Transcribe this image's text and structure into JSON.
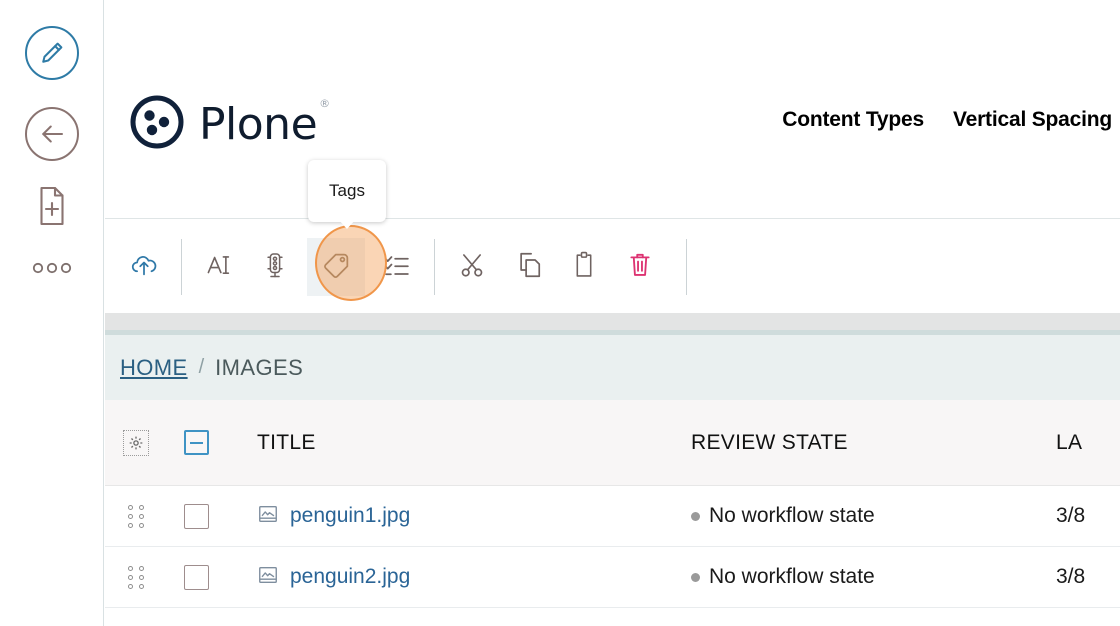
{
  "left_rail": {
    "items": [
      {
        "name": "edit",
        "icon": "pencil-circle-icon",
        "label": "Edit"
      },
      {
        "name": "back",
        "icon": "arrow-left-circle-icon",
        "label": "Back"
      },
      {
        "name": "add-content",
        "icon": "document-plus-icon",
        "label": "Add new content"
      },
      {
        "name": "more",
        "icon": "more-horizontal-icon",
        "label": "More"
      }
    ]
  },
  "header": {
    "logo_text": "Plone",
    "registered_mark": "®",
    "nav": [
      {
        "label": "Content Types"
      },
      {
        "label": "Vertical Spacing"
      }
    ]
  },
  "tooltip": {
    "label": "Tags",
    "for": "tags-button"
  },
  "toolbar": {
    "buttons": [
      {
        "name": "upload-button",
        "icon": "cloud-upload-icon",
        "label": "Upload",
        "color": "#3079a8",
        "active": false
      },
      {
        "name": "rename-button",
        "icon": "rename-ai-icon",
        "label": "Rename",
        "color": "#6f6361",
        "active": false
      },
      {
        "name": "workflow-state-button",
        "icon": "traffic-light-icon",
        "label": "Workflow state",
        "color": "#6f6361",
        "active": false
      },
      {
        "name": "tags-button",
        "icon": "tag-icon",
        "label": "Tags",
        "color": "#8a7b6c",
        "active": true
      },
      {
        "name": "properties-button",
        "icon": "checklist-icon",
        "label": "Properties",
        "color": "#6f6361",
        "active": false
      },
      {
        "name": "cut-button",
        "icon": "scissors-icon",
        "label": "Cut",
        "color": "#6f6361",
        "active": false
      },
      {
        "name": "copy-button",
        "icon": "copy-icon",
        "label": "Copy",
        "color": "#6f6361",
        "active": false
      },
      {
        "name": "paste-button",
        "icon": "clipboard-icon",
        "label": "Paste",
        "color": "#6f6361",
        "active": false
      },
      {
        "name": "delete-button",
        "icon": "trash-icon",
        "label": "Delete",
        "color": "#dd3372",
        "active": false
      }
    ]
  },
  "breadcrumb": {
    "home": "HOME",
    "separator": "/",
    "current": "IMAGES"
  },
  "table": {
    "headers": {
      "settings_icon": "gear-icon",
      "select_all": "indeterminate-checkbox",
      "title": "TITLE",
      "review_state": "REVIEW STATE",
      "last_modified": "LA"
    },
    "rows": [
      {
        "handle": "drag-handle-icon",
        "selected": false,
        "type_icon": "image-file-icon",
        "title": "penguin1.jpg",
        "review_state": "No workflow state",
        "state_color": "#9a9a9a",
        "last_modified": "3/8"
      },
      {
        "handle": "drag-handle-icon",
        "selected": false,
        "type_icon": "image-file-icon",
        "title": "penguin2.jpg",
        "review_state": "No workflow state",
        "state_color": "#9a9a9a",
        "last_modified": "3/8"
      }
    ]
  },
  "colors": {
    "accent_blue": "#2a6496",
    "rail_blue": "#2e7ba6",
    "rail_brown": "#8a7471",
    "delete_pink": "#dd3372",
    "highlight_orange": "#f0964a",
    "breadcrumb_bg": "#eaf0f0",
    "table_header_bg": "#f8f6f6"
  }
}
